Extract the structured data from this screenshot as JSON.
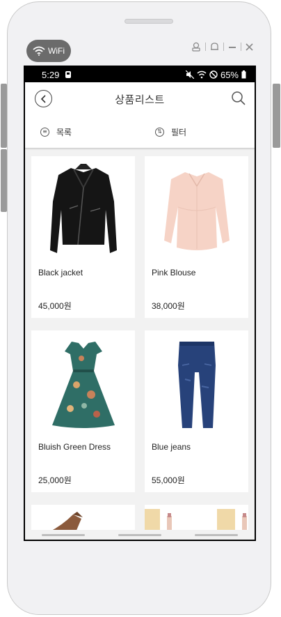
{
  "emulator": {
    "wifi_label": "WiFi",
    "controls": [
      "account-icon",
      "bell-icon",
      "minimize-icon",
      "close-icon"
    ]
  },
  "statusbar": {
    "time": "5:29",
    "battery": "65%"
  },
  "appbar": {
    "title": "상품리스트"
  },
  "toolbar": {
    "list_label": "목록",
    "filter_label": "필터"
  },
  "products": [
    {
      "name": "Black jacket",
      "price": "45,000원",
      "image": "black-leather-jacket"
    },
    {
      "name": "Pink Blouse",
      "price": "38,000원",
      "image": "pink-blouse"
    },
    {
      "name": "Bluish Green Dress",
      "price": "25,000원",
      "image": "floral-green-dress"
    },
    {
      "name": "Blue jeans",
      "price": "55,000원",
      "image": "blue-jeans"
    },
    {
      "name": "",
      "price": "",
      "image": "brown-shoes"
    },
    {
      "name": "",
      "price": "",
      "image": "cosmetics"
    }
  ],
  "colors": {
    "statusbar_bg": "#000000",
    "screen_bg": "#f2f2f2",
    "card_bg": "#ffffff",
    "text": "#222222"
  }
}
